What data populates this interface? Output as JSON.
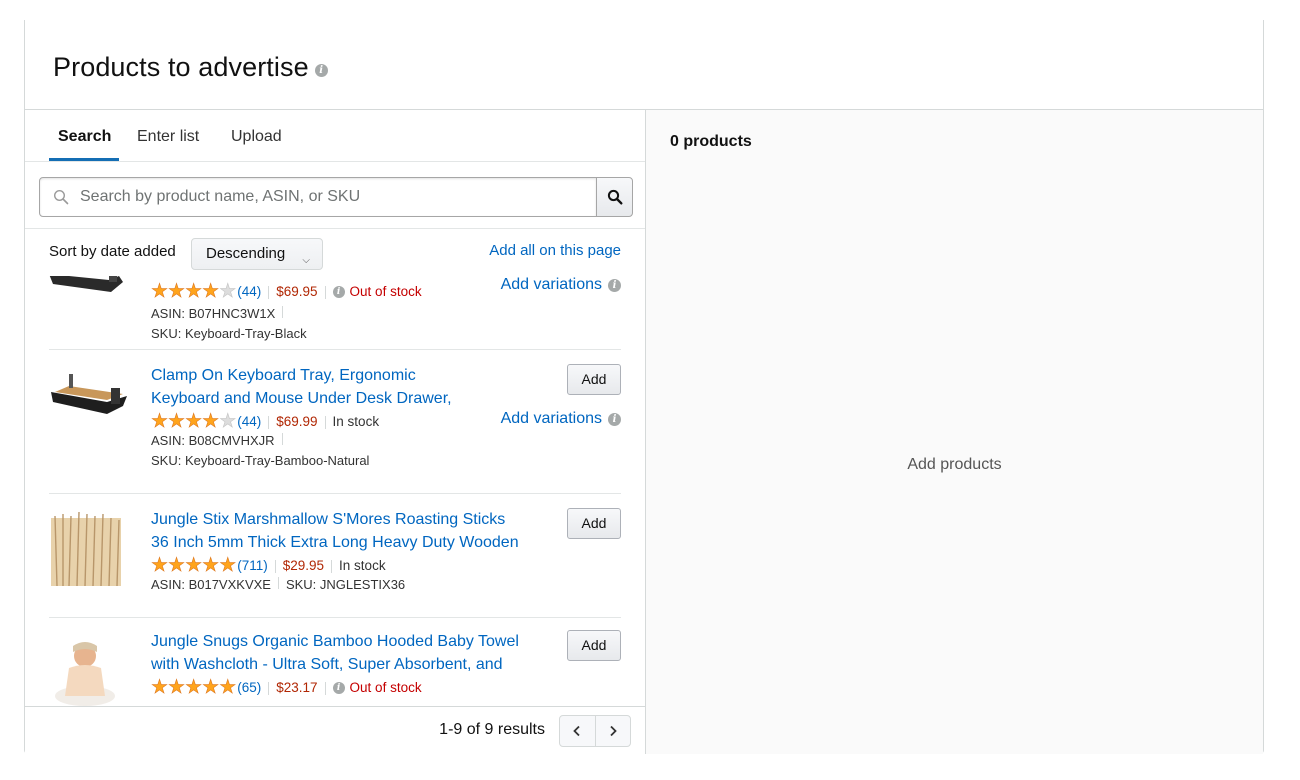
{
  "panel": {
    "title": "Products to advertise"
  },
  "tabs": [
    {
      "label": "Search",
      "active": true
    },
    {
      "label": "Enter list",
      "active": false
    },
    {
      "label": "Upload",
      "active": false
    }
  ],
  "search": {
    "placeholder": "Search by product name, ASIN, or SKU",
    "value": ""
  },
  "sort": {
    "label": "Sort by date added",
    "selected": "Descending",
    "add_all_label": "Add all on this page"
  },
  "products": [
    {
      "title_lines": [
        "",
        ""
      ],
      "rating": 4,
      "reviews": "(44)",
      "price": "$69.95",
      "stock": "Out of stock",
      "stock_status": "out",
      "asin": "ASIN: B07HNC3W1X",
      "sku": "SKU: Keyboard-Tray-Black",
      "add_variations_label": "Add variations"
    },
    {
      "title_lines": [
        "Clamp On Keyboard Tray, Ergonomic",
        "Keyboard and Mouse Under Desk Drawer,"
      ],
      "rating": 4,
      "reviews": "(44)",
      "price": "$69.99",
      "stock": "In stock",
      "stock_status": "in",
      "asin": "ASIN: B08CMVHXJR",
      "sku": "SKU: Keyboard-Tray-Bamboo-Natural",
      "add_label": "Add",
      "add_variations_label": "Add variations"
    },
    {
      "title_lines": [
        "Jungle Stix Marshmallow S'Mores Roasting Sticks",
        "36 Inch 5mm Thick Extra Long Heavy Duty Wooden"
      ],
      "rating": 5,
      "reviews": "(711)",
      "price": "$29.95",
      "stock": "In stock",
      "stock_status": "in",
      "asin": "ASIN: B017VXKVXE",
      "sku": "SKU: JNGLESTIX36",
      "add_label": "Add"
    },
    {
      "title_lines": [
        "Jungle Snugs Organic Bamboo Hooded Baby Towel",
        "with Washcloth - Ultra Soft, Super Absorbent, and"
      ],
      "rating": 5,
      "reviews": "(65)",
      "price": "$23.17",
      "stock": "Out of stock",
      "stock_status": "out",
      "add_label": "Add"
    }
  ],
  "pagination": {
    "results_text": "1-9 of 9 results"
  },
  "selected": {
    "count_label": "0 products",
    "empty_label": "Add products"
  },
  "colors": {
    "link": "#0066c0",
    "price": "#b12704",
    "out_of_stock": "#c40000",
    "star": "#ffa41c",
    "tab_underline": "#146eb4"
  }
}
